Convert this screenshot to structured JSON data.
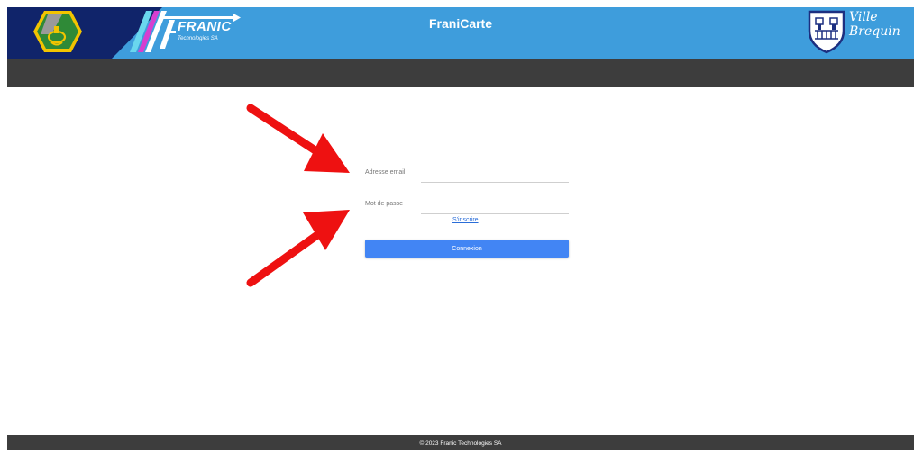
{
  "header": {
    "app_title": "FraniCarte",
    "company_name": "FRANIC",
    "company_sub": "Technologies SA",
    "city_line1": "Ville",
    "city_line2": "Brequin",
    "colors": {
      "header_blue": "#3e9ddc",
      "navy": "#10246a",
      "bar": "#3d3d3d"
    }
  },
  "login": {
    "email_label": "Adresse email",
    "email_value": "",
    "password_label": "Mot de passe",
    "password_value": "",
    "signup_link": "S'inscrire",
    "submit_label": "Connexion",
    "button_color": "#4285f4"
  },
  "footer": {
    "copyright": "© 2023 Franic Technologies SA"
  },
  "annotations": {
    "arrow_color": "#ee1111",
    "arrow_targets": [
      "email-field",
      "password-field"
    ]
  }
}
